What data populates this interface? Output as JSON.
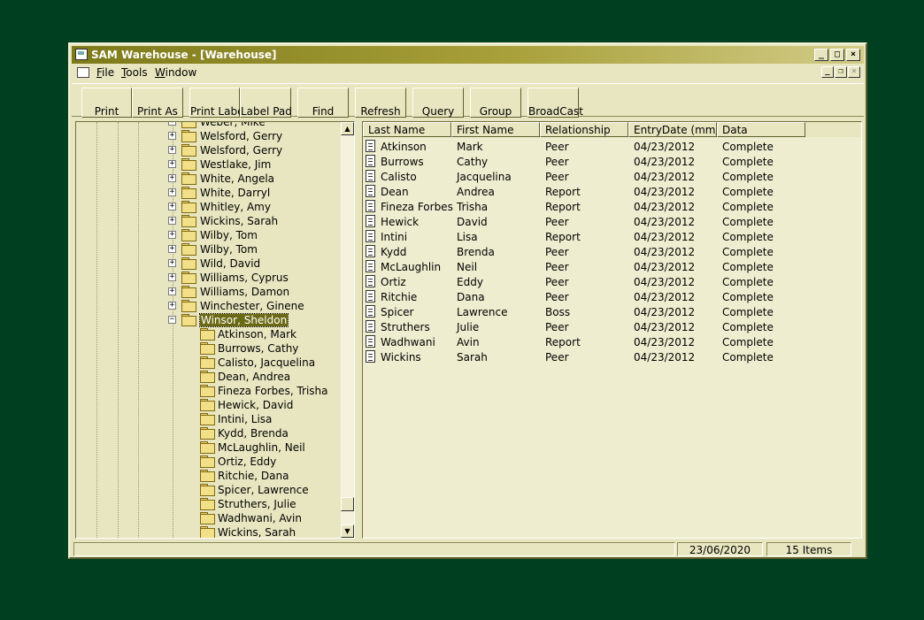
{
  "window": {
    "title": "SAM Warehouse - [Warehouse]",
    "caption_buttons": {
      "minimize": "_",
      "maximize": "□",
      "close": "×"
    },
    "mdi_buttons": {
      "minimize": "_",
      "restore": "❐",
      "close": "×"
    }
  },
  "menu": {
    "items": [
      {
        "label": "File",
        "underline": "F"
      },
      {
        "label": "Tools",
        "underline": "T"
      },
      {
        "label": "Window",
        "underline": "W"
      }
    ]
  },
  "toolbar": {
    "buttons": [
      {
        "label": "Print"
      },
      {
        "label": "Print As"
      },
      {
        "label": "Print Label"
      },
      {
        "label": "Label Pad"
      },
      {
        "label": "Find"
      },
      {
        "label": "Refresh"
      },
      {
        "label": "Query"
      },
      {
        "label": "Group"
      },
      {
        "label": "BroadCast"
      }
    ]
  },
  "tree": {
    "top_items": [
      "Weber, Mike",
      "Welsford, Gerry",
      "Welsford, Gerry",
      "Westlake, Jim",
      "White, Angela",
      "White, Darryl",
      "Whitley, Amy",
      "Wickins, Sarah",
      "Wilby, Tom",
      "Wilby, Tom",
      "Wild, David",
      "Williams, Cyprus",
      "Williams, Damon",
      "Winchester, Ginene"
    ],
    "selected": "Winsor, Sheldon",
    "children": [
      "Atkinson, Mark",
      "Burrows, Cathy",
      "Calisto, Jacquelina",
      "Dean, Andrea",
      "Fineza Forbes, Trisha",
      "Hewick, David",
      "Intini, Lisa",
      "Kydd, Brenda",
      "McLaughlin, Neil",
      "Ortiz, Eddy",
      "Ritchie, Dana",
      "Spicer, Lawrence",
      "Struthers, Julie",
      "Wadhwani, Avin",
      "Wickins, Sarah"
    ],
    "expand_symbol": "+",
    "collapse_symbol": "−"
  },
  "list": {
    "columns": [
      "Last Name",
      "First Name",
      "Relationship",
      "EntryDate (mm/...",
      "Data"
    ],
    "rows": [
      [
        "Atkinson",
        "Mark",
        "Peer",
        "04/23/2012",
        "Complete"
      ],
      [
        "Burrows",
        "Cathy",
        "Peer",
        "04/23/2012",
        "Complete"
      ],
      [
        "Calisto",
        "Jacquelina",
        "Peer",
        "04/23/2012",
        "Complete"
      ],
      [
        "Dean",
        "Andrea",
        "Report",
        "04/23/2012",
        "Complete"
      ],
      [
        "Fineza Forbes",
        "Trisha",
        "Report",
        "04/23/2012",
        "Complete"
      ],
      [
        "Hewick",
        "David",
        "Peer",
        "04/23/2012",
        "Complete"
      ],
      [
        "Intini",
        "Lisa",
        "Report",
        "04/23/2012",
        "Complete"
      ],
      [
        "Kydd",
        "Brenda",
        "Peer",
        "04/23/2012",
        "Complete"
      ],
      [
        "McLaughlin",
        "Neil",
        "Peer",
        "04/23/2012",
        "Complete"
      ],
      [
        "Ortiz",
        "Eddy",
        "Peer",
        "04/23/2012",
        "Complete"
      ],
      [
        "Ritchie",
        "Dana",
        "Peer",
        "04/23/2012",
        "Complete"
      ],
      [
        "Spicer",
        "Lawrence",
        "Boss",
        "04/23/2012",
        "Complete"
      ],
      [
        "Struthers",
        "Julie",
        "Peer",
        "04/23/2012",
        "Complete"
      ],
      [
        "Wadhwani",
        "Avin",
        "Report",
        "04/23/2012",
        "Complete"
      ],
      [
        "Wickins",
        "Sarah",
        "Peer",
        "04/23/2012",
        "Complete"
      ]
    ]
  },
  "status": {
    "date": "23/06/2020",
    "items": "15 Items"
  },
  "colors": {
    "desktop": "#003f1f",
    "face": "#e8e6c0",
    "selection": "#6b6a14"
  },
  "scroll": {
    "up_arrow": "▲",
    "down_arrow": "▼"
  }
}
